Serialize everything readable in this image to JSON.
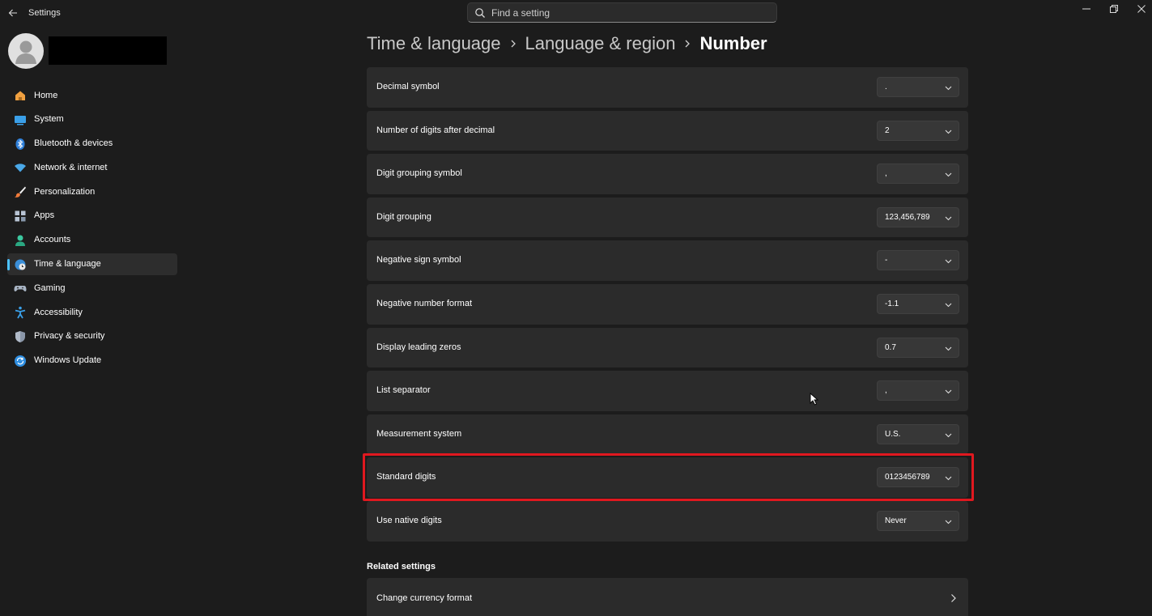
{
  "app": {
    "title": "Settings"
  },
  "search": {
    "placeholder": "Find a setting"
  },
  "sidebar": {
    "items": [
      {
        "label": "Home",
        "icon": "home-icon"
      },
      {
        "label": "System",
        "icon": "system-icon"
      },
      {
        "label": "Bluetooth & devices",
        "icon": "bluetooth-icon"
      },
      {
        "label": "Network & internet",
        "icon": "wifi-icon"
      },
      {
        "label": "Personalization",
        "icon": "brush-icon"
      },
      {
        "label": "Apps",
        "icon": "apps-icon"
      },
      {
        "label": "Accounts",
        "icon": "accounts-icon"
      },
      {
        "label": "Time & language",
        "icon": "time-language-icon",
        "active": true
      },
      {
        "label": "Gaming",
        "icon": "gaming-icon"
      },
      {
        "label": "Accessibility",
        "icon": "accessibility-icon"
      },
      {
        "label": "Privacy & security",
        "icon": "shield-icon"
      },
      {
        "label": "Windows Update",
        "icon": "windows-update-icon"
      }
    ]
  },
  "breadcrumb": {
    "items": [
      "Time & language",
      "Language & region",
      "Number"
    ]
  },
  "settings": {
    "rows": [
      {
        "label": "Decimal symbol",
        "value": "."
      },
      {
        "label": "Number of digits after decimal",
        "value": "2"
      },
      {
        "label": "Digit grouping symbol",
        "value": ","
      },
      {
        "label": "Digit grouping",
        "value": "123,456,789"
      },
      {
        "label": "Negative sign symbol",
        "value": "-"
      },
      {
        "label": "Negative number format",
        "value": "-1.1"
      },
      {
        "label": "Display leading zeros",
        "value": "0.7"
      },
      {
        "label": "List separator",
        "value": ","
      },
      {
        "label": "Measurement system",
        "value": "U.S."
      },
      {
        "label": "Standard digits",
        "value": "0123456789"
      },
      {
        "label": "Use native digits",
        "value": "Never"
      }
    ]
  },
  "related": {
    "title": "Related settings",
    "items": [
      {
        "label": "Change currency format"
      }
    ]
  },
  "colors": {
    "accent": "#4cc2ff",
    "highlight": "#e0181f",
    "background": "#1c1c1c",
    "card": "#2b2b2b"
  }
}
